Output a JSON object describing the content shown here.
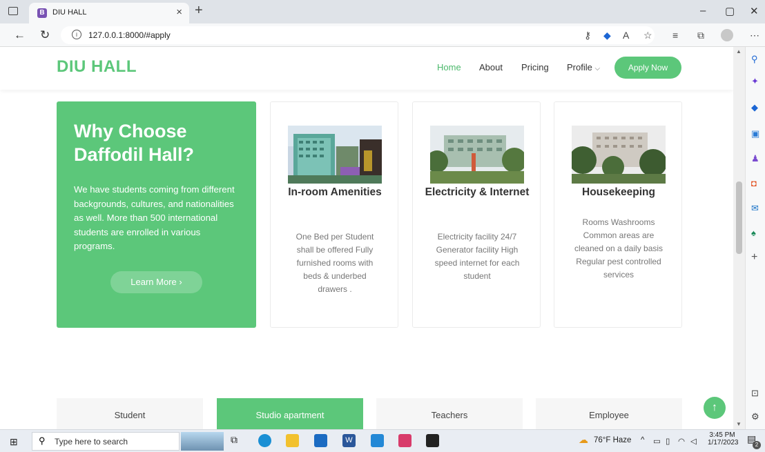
{
  "browser": {
    "tab_title": "DIU HALL",
    "tab_favicon": "B",
    "url": "127.0.0.1:8000/#apply"
  },
  "site": {
    "logo": "DIU HALL",
    "nav": {
      "home": "Home",
      "about": "About",
      "pricing": "Pricing",
      "profile": "Profile",
      "apply": "Apply Now"
    },
    "accent_color": "#5cc77a"
  },
  "hero": {
    "title": "Why Choose Daffodil Hall?",
    "text": "We have students coming from different backgrounds, cultures, and nationalities as well. More than 500 international students are enrolled in various programs.",
    "button": "Learn More"
  },
  "cards": [
    {
      "title": "In-room Amenities",
      "text": "One Bed per Student shall be offered Fully furnished rooms with beds & underbed drawers ."
    },
    {
      "title": "Electricity & Internet",
      "text": "Electricity facility 24/7 Generator facility High speed internet for each student"
    },
    {
      "title": "Housekeeping",
      "text": "Rooms Washrooms Common areas are cleaned on a daily basis Regular pest controlled services"
    }
  ],
  "tabs": [
    "Student",
    "Studio apartment",
    "Teachers",
    "Employee"
  ],
  "taskbar": {
    "search_placeholder": "Type here to search",
    "weather": "76°F  Haze",
    "time": "3:45 PM",
    "date": "1/17/2023",
    "notifications": "2"
  }
}
